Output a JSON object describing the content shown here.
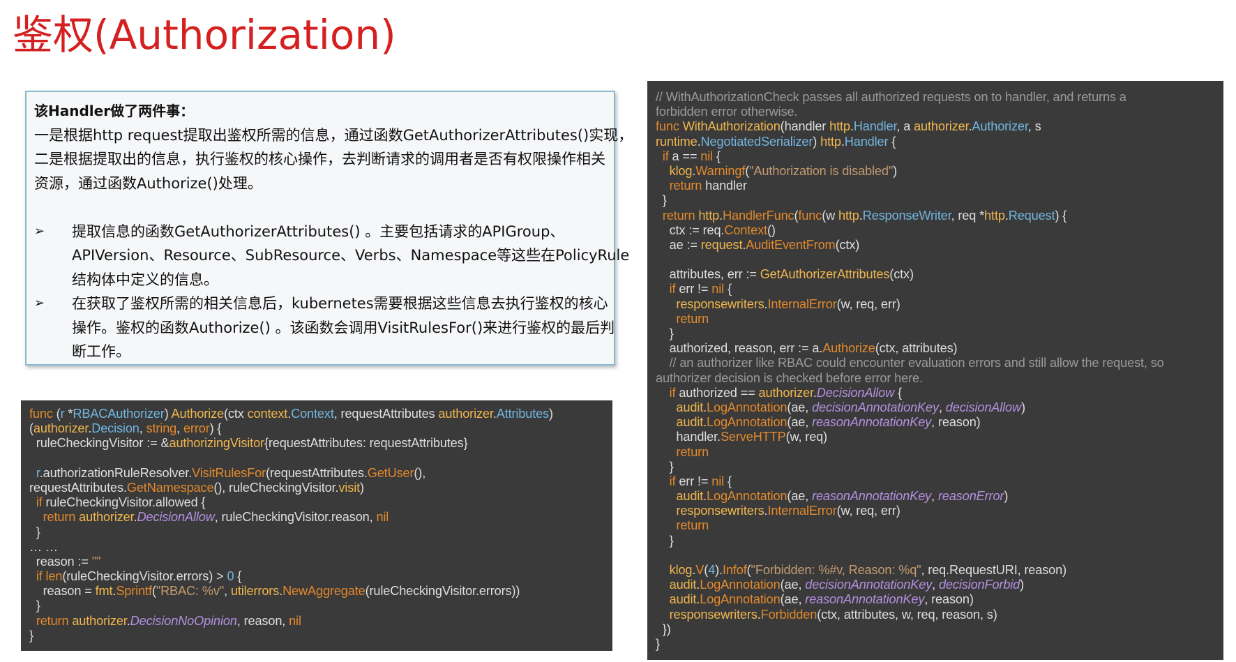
{
  "title": "鉴权(Authorization)",
  "description": {
    "heading": "该Handler做了两件事：",
    "intro_lines": [
      "一是根据http request提取出鉴权所需的信息，通过函数GetAuthorizerAttributes()实现，",
      "二是根据提取出的信息，执行鉴权的核心操作，去判断请求的调用者是否有权限操作相关",
      "资源，通过函数Authorize()处理。"
    ],
    "bullet_symbol": "➢",
    "bullets": [
      {
        "lines": [
          "提取信息的函数GetAuthorizerAttributes() 。主要包括请求的APIGroup、",
          "APIVersion、Resource、SubResource、Verbs、Namespace等这些在PolicyRule",
          "结构体中定义的信息。"
        ]
      },
      {
        "lines": [
          "在获取了鉴权所需的相关信息后，kubernetes需要根据这些信息去执行鉴权的核心",
          "操作。鉴权的函数Authorize() 。该函数会调用VisitRulesFor()来进行鉴权的最后判",
          "断工作。"
        ]
      }
    ]
  },
  "code_left": [
    [
      [
        "k",
        "func"
      ],
      [
        "p",
        " ("
      ],
      [
        "t",
        "r"
      ],
      [
        "p",
        " *"
      ],
      [
        "t",
        "RBACAuthorizer"
      ],
      [
        "p",
        ") "
      ],
      [
        "f",
        "Authorize"
      ],
      [
        "p",
        "(ctx "
      ],
      [
        "f",
        "context"
      ],
      [
        "p",
        "."
      ],
      [
        "t",
        "Context"
      ],
      [
        "p",
        ", requestAttributes "
      ],
      [
        "f",
        "authorizer"
      ],
      [
        "p",
        "."
      ],
      [
        "t",
        "Attributes"
      ],
      [
        "p",
        ")"
      ]
    ],
    [
      [
        "p",
        "("
      ],
      [
        "f",
        "authorizer"
      ],
      [
        "p",
        "."
      ],
      [
        "t",
        "Decision"
      ],
      [
        "p",
        ", "
      ],
      [
        "k",
        "string"
      ],
      [
        "p",
        ", "
      ],
      [
        "k",
        "error"
      ],
      [
        "p",
        ") {"
      ]
    ],
    [
      [
        "p",
        "  ruleCheckingVisitor := &"
      ],
      [
        "f",
        "authorizingVisitor"
      ],
      [
        "p",
        "{requestAttributes: requestAttributes}"
      ]
    ],
    [
      [
        "p",
        ""
      ]
    ],
    [
      [
        "p",
        "  "
      ],
      [
        "t",
        "r"
      ],
      [
        "p",
        ".authorizationRuleResolver."
      ],
      [
        "k",
        "VisitRulesFor"
      ],
      [
        "p",
        "(requestAttributes."
      ],
      [
        "k",
        "GetUser"
      ],
      [
        "p",
        "(),"
      ]
    ],
    [
      [
        "p",
        "requestAttributes."
      ],
      [
        "k",
        "GetNamespace"
      ],
      [
        "p",
        "(), ruleCheckingVisitor."
      ],
      [
        "f",
        "visit"
      ],
      [
        "p",
        ")"
      ]
    ],
    [
      [
        "p",
        "  "
      ],
      [
        "k",
        "if"
      ],
      [
        "p",
        " ruleCheckingVisitor.allowed {"
      ]
    ],
    [
      [
        "p",
        "    "
      ],
      [
        "k",
        "return"
      ],
      [
        "p",
        " "
      ],
      [
        "f",
        "authorizer"
      ],
      [
        "p",
        "."
      ],
      [
        "i",
        "DecisionAllow"
      ],
      [
        "p",
        ", ruleCheckingVisitor.reason, "
      ],
      [
        "k",
        "nil"
      ]
    ],
    [
      [
        "p",
        "  }"
      ]
    ],
    [
      [
        "p",
        "… …"
      ]
    ],
    [
      [
        "p",
        "  reason := "
      ],
      [
        "s",
        "\"\""
      ]
    ],
    [
      [
        "p",
        "  "
      ],
      [
        "k",
        "if"
      ],
      [
        "p",
        " "
      ],
      [
        "k",
        "len"
      ],
      [
        "p",
        "(ruleCheckingVisitor.errors) > "
      ],
      [
        "t",
        "0"
      ],
      [
        "p",
        " {"
      ]
    ],
    [
      [
        "p",
        "    reason = "
      ],
      [
        "f",
        "fmt"
      ],
      [
        "p",
        "."
      ],
      [
        "k",
        "Sprintf"
      ],
      [
        "p",
        "("
      ],
      [
        "s",
        "\"RBAC: %v\""
      ],
      [
        "p",
        ", "
      ],
      [
        "f",
        "utilerrors"
      ],
      [
        "p",
        "."
      ],
      [
        "k",
        "NewAggregate"
      ],
      [
        "p",
        "(ruleCheckingVisitor.errors))"
      ]
    ],
    [
      [
        "p",
        "  }"
      ]
    ],
    [
      [
        "p",
        "  "
      ],
      [
        "k",
        "return"
      ],
      [
        "p",
        " "
      ],
      [
        "f",
        "authorizer"
      ],
      [
        "p",
        "."
      ],
      [
        "i",
        "DecisionNoOpinion"
      ],
      [
        "p",
        ", reason, "
      ],
      [
        "k",
        "nil"
      ]
    ],
    [
      [
        "p",
        "}"
      ]
    ]
  ],
  "code_right": [
    [
      [
        "c",
        "// WithAuthorizationCheck passes all authorized requests on to handler, and returns a"
      ]
    ],
    [
      [
        "c",
        "forbidden error otherwise."
      ]
    ],
    [
      [
        "k",
        "func"
      ],
      [
        "p",
        " "
      ],
      [
        "f",
        "WithAuthorization"
      ],
      [
        "p",
        "(handler "
      ],
      [
        "f",
        "http"
      ],
      [
        "p",
        "."
      ],
      [
        "t",
        "Handler"
      ],
      [
        "p",
        ", a "
      ],
      [
        "f",
        "authorizer"
      ],
      [
        "p",
        "."
      ],
      [
        "t",
        "Authorizer"
      ],
      [
        "p",
        ", s"
      ]
    ],
    [
      [
        "f",
        "runtime"
      ],
      [
        "p",
        "."
      ],
      [
        "t",
        "NegotiatedSerializer"
      ],
      [
        "p",
        ") "
      ],
      [
        "f",
        "http"
      ],
      [
        "p",
        "."
      ],
      [
        "t",
        "Handler"
      ],
      [
        "p",
        " {"
      ]
    ],
    [
      [
        "p",
        "  "
      ],
      [
        "k",
        "if"
      ],
      [
        "p",
        " a == "
      ],
      [
        "k",
        "nil"
      ],
      [
        "p",
        " {"
      ]
    ],
    [
      [
        "p",
        "    "
      ],
      [
        "f",
        "klog"
      ],
      [
        "p",
        "."
      ],
      [
        "k",
        "Warningf"
      ],
      [
        "p",
        "("
      ],
      [
        "s",
        "\"Authorization is disabled\""
      ],
      [
        "p",
        ")"
      ]
    ],
    [
      [
        "p",
        "    "
      ],
      [
        "k",
        "return"
      ],
      [
        "p",
        " handler"
      ]
    ],
    [
      [
        "p",
        "  }"
      ]
    ],
    [
      [
        "p",
        "  "
      ],
      [
        "k",
        "return"
      ],
      [
        "p",
        " "
      ],
      [
        "f",
        "http"
      ],
      [
        "p",
        "."
      ],
      [
        "k",
        "HandlerFunc"
      ],
      [
        "p",
        "("
      ],
      [
        "k",
        "func"
      ],
      [
        "p",
        "(w "
      ],
      [
        "f",
        "http"
      ],
      [
        "p",
        "."
      ],
      [
        "t",
        "ResponseWriter"
      ],
      [
        "p",
        ", req *"
      ],
      [
        "f",
        "http"
      ],
      [
        "p",
        "."
      ],
      [
        "t",
        "Request"
      ],
      [
        "p",
        ") {"
      ]
    ],
    [
      [
        "p",
        "    ctx := req."
      ],
      [
        "k",
        "Context"
      ],
      [
        "p",
        "()"
      ]
    ],
    [
      [
        "p",
        "    ae := "
      ],
      [
        "f",
        "request"
      ],
      [
        "p",
        "."
      ],
      [
        "k",
        "AuditEventFrom"
      ],
      [
        "p",
        "(ctx)"
      ]
    ],
    [
      [
        "p",
        ""
      ]
    ],
    [
      [
        "p",
        "    attributes, err := "
      ],
      [
        "f",
        "GetAuthorizerAttributes"
      ],
      [
        "p",
        "(ctx)"
      ]
    ],
    [
      [
        "p",
        "    "
      ],
      [
        "k",
        "if"
      ],
      [
        "p",
        " err != "
      ],
      [
        "k",
        "nil"
      ],
      [
        "p",
        " {"
      ]
    ],
    [
      [
        "p",
        "      "
      ],
      [
        "f",
        "responsewriters"
      ],
      [
        "p",
        "."
      ],
      [
        "k",
        "InternalError"
      ],
      [
        "p",
        "(w, req, err)"
      ]
    ],
    [
      [
        "p",
        "      "
      ],
      [
        "k",
        "return"
      ]
    ],
    [
      [
        "p",
        "    }"
      ]
    ],
    [
      [
        "p",
        "    authorized, reason, err := a."
      ],
      [
        "k",
        "Authorize"
      ],
      [
        "p",
        "(ctx, attributes)"
      ]
    ],
    [
      [
        "c",
        "    // an authorizer like RBAC could encounter evaluation errors and still allow the request, so"
      ]
    ],
    [
      [
        "c",
        "authorizer decision is checked before error here."
      ]
    ],
    [
      [
        "p",
        "    "
      ],
      [
        "k",
        "if"
      ],
      [
        "p",
        " authorized == "
      ],
      [
        "f",
        "authorizer"
      ],
      [
        "p",
        "."
      ],
      [
        "i",
        "DecisionAllow"
      ],
      [
        "p",
        " {"
      ]
    ],
    [
      [
        "p",
        "      "
      ],
      [
        "f",
        "audit"
      ],
      [
        "p",
        "."
      ],
      [
        "k",
        "LogAnnotation"
      ],
      [
        "p",
        "(ae, "
      ],
      [
        "i",
        "decisionAnnotationKey"
      ],
      [
        "p",
        ", "
      ],
      [
        "i",
        "decisionAllow"
      ],
      [
        "p",
        ")"
      ]
    ],
    [
      [
        "p",
        "      "
      ],
      [
        "f",
        "audit"
      ],
      [
        "p",
        "."
      ],
      [
        "k",
        "LogAnnotation"
      ],
      [
        "p",
        "(ae, "
      ],
      [
        "i",
        "reasonAnnotationKey"
      ],
      [
        "p",
        ", reason)"
      ]
    ],
    [
      [
        "p",
        "      handler."
      ],
      [
        "k",
        "ServeHTTP"
      ],
      [
        "p",
        "(w, req)"
      ]
    ],
    [
      [
        "p",
        "      "
      ],
      [
        "k",
        "return"
      ]
    ],
    [
      [
        "p",
        "    }"
      ]
    ],
    [
      [
        "p",
        "    "
      ],
      [
        "k",
        "if"
      ],
      [
        "p",
        " err != "
      ],
      [
        "k",
        "nil"
      ],
      [
        "p",
        " {"
      ]
    ],
    [
      [
        "p",
        "      "
      ],
      [
        "f",
        "audit"
      ],
      [
        "p",
        "."
      ],
      [
        "k",
        "LogAnnotation"
      ],
      [
        "p",
        "(ae, "
      ],
      [
        "i",
        "reasonAnnotationKey"
      ],
      [
        "p",
        ", "
      ],
      [
        "i",
        "reasonError"
      ],
      [
        "p",
        ")"
      ]
    ],
    [
      [
        "p",
        "      "
      ],
      [
        "f",
        "responsewriters"
      ],
      [
        "p",
        "."
      ],
      [
        "k",
        "InternalError"
      ],
      [
        "p",
        "(w, req, err)"
      ]
    ],
    [
      [
        "p",
        "      "
      ],
      [
        "k",
        "return"
      ]
    ],
    [
      [
        "p",
        "    }"
      ]
    ],
    [
      [
        "p",
        ""
      ]
    ],
    [
      [
        "p",
        "    "
      ],
      [
        "f",
        "klog"
      ],
      [
        "p",
        "."
      ],
      [
        "k",
        "V"
      ],
      [
        "p",
        "("
      ],
      [
        "t",
        "4"
      ],
      [
        "p",
        ")."
      ],
      [
        "k",
        "Infof"
      ],
      [
        "p",
        "("
      ],
      [
        "s",
        "\"Forbidden: %#v, Reason: %q\""
      ],
      [
        "p",
        ", req.RequestURI, reason)"
      ]
    ],
    [
      [
        "p",
        "    "
      ],
      [
        "f",
        "audit"
      ],
      [
        "p",
        "."
      ],
      [
        "k",
        "LogAnnotation"
      ],
      [
        "p",
        "(ae, "
      ],
      [
        "i",
        "decisionAnnotationKey"
      ],
      [
        "p",
        ", "
      ],
      [
        "i",
        "decisionForbid"
      ],
      [
        "p",
        ")"
      ]
    ],
    [
      [
        "p",
        "    "
      ],
      [
        "f",
        "audit"
      ],
      [
        "p",
        "."
      ],
      [
        "k",
        "LogAnnotation"
      ],
      [
        "p",
        "(ae, "
      ],
      [
        "i",
        "reasonAnnotationKey"
      ],
      [
        "p",
        ", reason)"
      ]
    ],
    [
      [
        "p",
        "    "
      ],
      [
        "f",
        "responsewriters"
      ],
      [
        "p",
        "."
      ],
      [
        "k",
        "Forbidden"
      ],
      [
        "p",
        "(ctx, attributes, w, req, reason, s)"
      ]
    ],
    [
      [
        "p",
        "  })"
      ]
    ],
    [
      [
        "p",
        "}"
      ]
    ]
  ],
  "colors": {
    "title": "#d42020",
    "box_border": "#86bcd0",
    "code_background": "#3a3a3a",
    "keyword": "#e2892c",
    "identifier": "#f0b64e",
    "type": "#72b6e0",
    "string": "#c39b70",
    "comment": "#9a9a9a",
    "italic_const": "#b490e0"
  }
}
